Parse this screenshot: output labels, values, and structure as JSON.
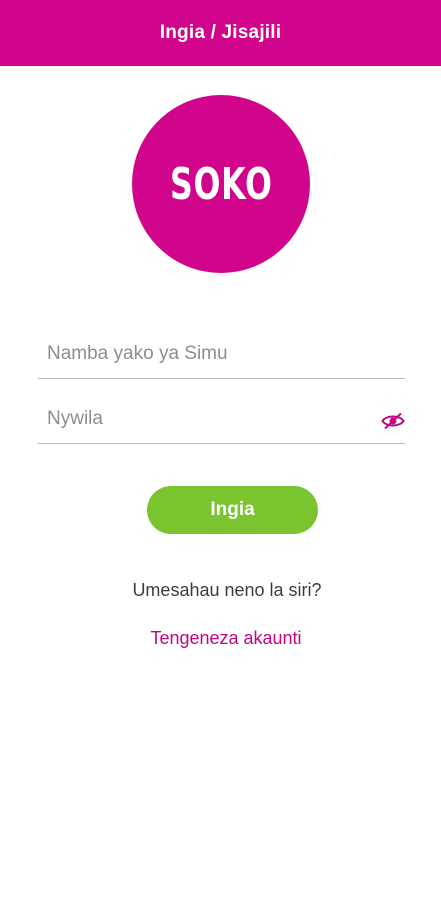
{
  "app_bar": {
    "title": "Ingia / Jisajili"
  },
  "logo": {
    "text": "SOKO"
  },
  "form": {
    "phone_placeholder": "Namba yako ya Simu",
    "password_placeholder": "Nywila",
    "login_label": "Ingia"
  },
  "links": {
    "forgot_password": "Umesahau neno la siri?",
    "create_account": "Tengeneza akaunti"
  },
  "colors": {
    "brand": "#d0058c",
    "button_green": "#7ac52f",
    "link": "#c0077f"
  },
  "icons": {
    "password_toggle": "eye-slash-icon"
  }
}
